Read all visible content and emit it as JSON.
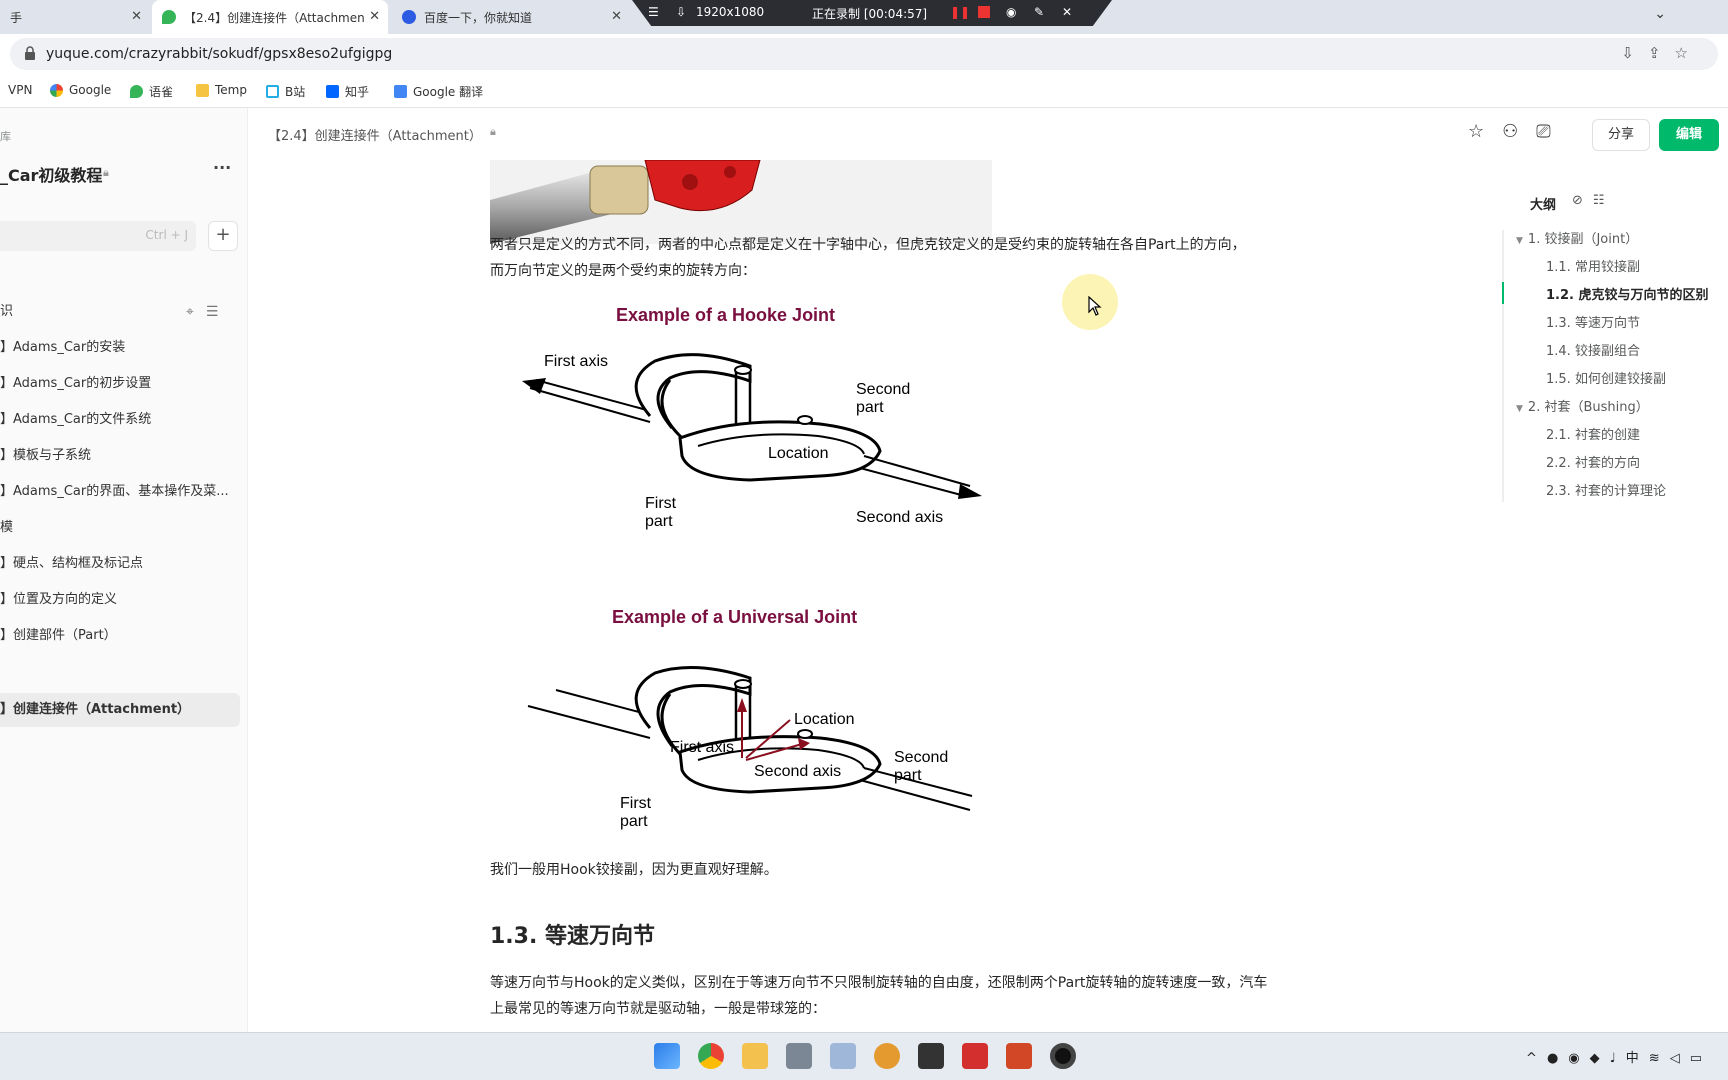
{
  "browser": {
    "tabs": [
      {
        "label": "手"
      },
      {
        "label": "【2.4】创建连接件（Attachmen"
      },
      {
        "label": "百度一下，你就知道"
      }
    ],
    "recorder": {
      "resolution": "1920x1080",
      "status": "正在录制 [00:04:57]"
    },
    "url": "yuque.com/crazyrabbit/sokudf/gpsx8eso2ufgigpg",
    "bookmarks": [
      "VPN",
      "Google",
      "语雀",
      "Temp",
      "B站",
      "知乎",
      "Google 翻译"
    ]
  },
  "sidebar": {
    "small_label": "库",
    "book_title": "_Car初级教程",
    "more": "···",
    "search_shortcut": "Ctrl + J",
    "plus": "+",
    "items": [
      {
        "label": "识"
      },
      {
        "label": "】Adams_Car的安装"
      },
      {
        "label": "】Adams_Car的初步设置"
      },
      {
        "label": "】Adams_Car的文件系统"
      },
      {
        "label": "】模板与子系统"
      },
      {
        "label": "】Adams_Car的界面、基本操作及菜..."
      },
      {
        "label": "模"
      },
      {
        "label": "】硬点、结构框及标记点"
      },
      {
        "label": "】位置及方向的定义"
      },
      {
        "label": "】创建部件（Part）"
      },
      {
        "label": "】创建连接件（Attachment）"
      }
    ]
  },
  "doc": {
    "header_title": "【2.4】创建连接件（Attachment）",
    "share_label": "分享",
    "edit_label": "编辑",
    "para1": "两者只是定义的方式不同，两者的中心点都是定义在十字轴中心，但虎克铰定义的是受约束的旋转轴在各自Part上的方向，而万向节定义的是两个受约束的旋转方向：",
    "hooke": {
      "title": "Example of a Hooke Joint",
      "first_axis": "First axis",
      "second_part_1": "Second",
      "second_part_2": "part",
      "location": "Location",
      "first_part_1": "First",
      "first_part_2": "part",
      "second_axis": "Second axis"
    },
    "universal": {
      "title": "Example of a Universal Joint",
      "location": "Location",
      "first_axis": "First axis",
      "second_axis": "Second axis",
      "second_part_1": "Second",
      "second_part_2": "part",
      "first_part_1": "First",
      "first_part_2": "part"
    },
    "para2": "我们一般用Hook铰接副，因为更直观好理解。",
    "heading": "1.3. 等速万向节",
    "para3": "等速万向节与Hook的定义类似，区别在于等速万向节不只限制旋转轴的自由度，还限制两个Part旋转轴的旋转速度一致，汽车上最常见的等速万向节就是驱动轴，一般是带球笼的："
  },
  "outline": {
    "title": "大纲",
    "items": [
      {
        "label": "1. 铰接副（Joint）"
      },
      {
        "label": "1.1. 常用铰接副"
      },
      {
        "label": "1.2. 虎克铰与万向节的区别"
      },
      {
        "label": "1.3. 等速万向节"
      },
      {
        "label": "1.4. 铰接副组合"
      },
      {
        "label": "1.5. 如何创建铰接副"
      },
      {
        "label": "2. 衬套（Bushing）"
      },
      {
        "label": "2.1. 衬套的创建"
      },
      {
        "label": "2.2. 衬套的方向"
      },
      {
        "label": "2.3. 衬套的计算理论"
      }
    ]
  },
  "taskbar": {
    "tray_input": "中"
  },
  "colors": {
    "accent": "#00b96b",
    "diagram_title": "#7a1040"
  }
}
